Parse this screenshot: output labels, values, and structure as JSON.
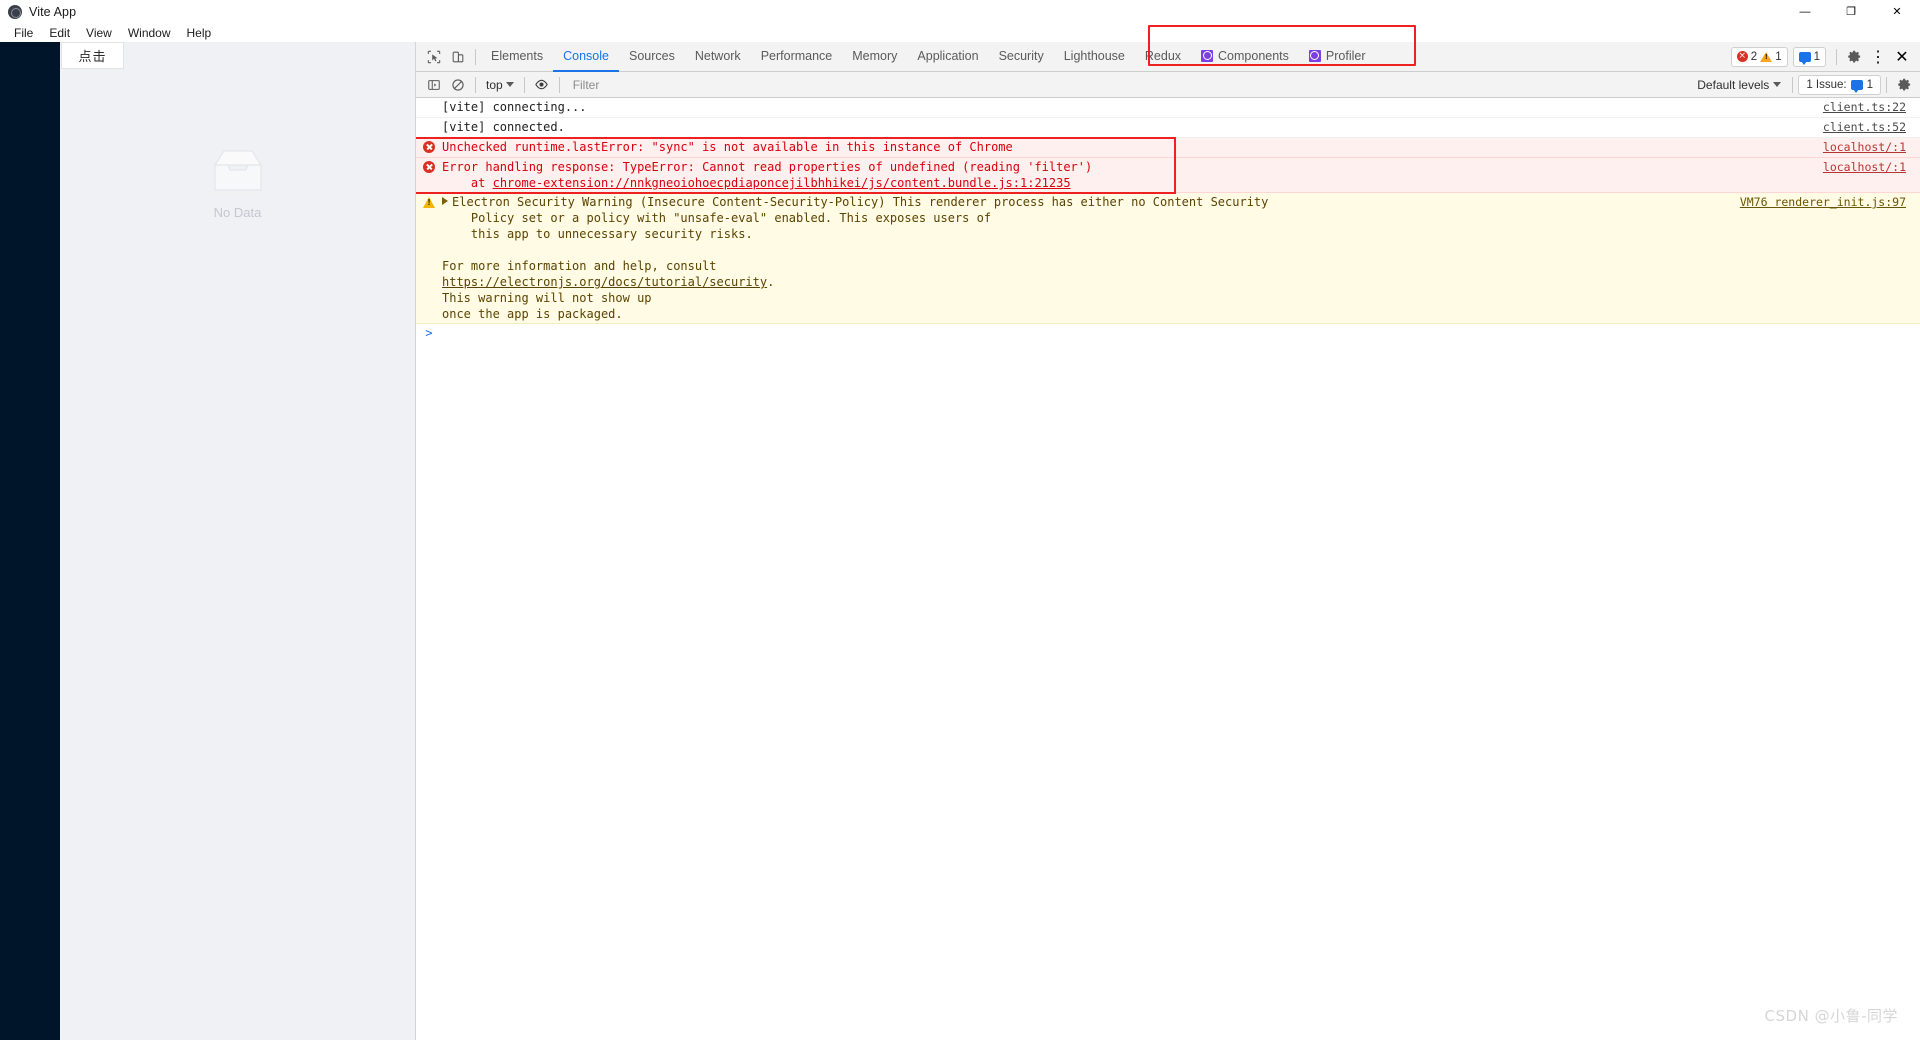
{
  "window": {
    "title": "Vite App",
    "minimize_label": "—",
    "maximize_label": "❐",
    "close_label": "✕"
  },
  "menubar": {
    "items": [
      "File",
      "Edit",
      "View",
      "Window",
      "Help"
    ]
  },
  "app": {
    "click_button_label": "点击",
    "empty_text": "No Data",
    "sidebar_color": "#001529"
  },
  "devtools": {
    "tabs": [
      {
        "label": "Elements",
        "active": false
      },
      {
        "label": "Console",
        "active": true
      },
      {
        "label": "Sources",
        "active": false
      },
      {
        "label": "Network",
        "active": false
      },
      {
        "label": "Performance",
        "active": false
      },
      {
        "label": "Memory",
        "active": false
      },
      {
        "label": "Application",
        "active": false
      },
      {
        "label": "Security",
        "active": false
      },
      {
        "label": "Lighthouse",
        "active": false
      }
    ],
    "extension_tabs": [
      {
        "label": "Redux",
        "icon": false
      },
      {
        "label": "Components",
        "icon": true
      },
      {
        "label": "Profiler",
        "icon": true
      }
    ],
    "counters": {
      "errors": "2",
      "warnings": "1",
      "messages": "1"
    },
    "settings_label": "⚙",
    "more_label": "⋮",
    "close_label": "✕",
    "active_tab_color": "#1a73e8",
    "highlight_color": "#ef2020"
  },
  "console_toolbar": {
    "context": "top",
    "filter_placeholder": "Filter",
    "filter_value": "",
    "levels": "Default levels",
    "issues_label": "1 Issue:",
    "issues_count": "1"
  },
  "console_messages": [
    {
      "kind": "log",
      "text": "[vite] connecting...",
      "source": "client.ts:22"
    },
    {
      "kind": "log",
      "text": "[vite] connected.",
      "source": "client.ts:52"
    },
    {
      "kind": "error",
      "text": "Unchecked runtime.lastError: \"sync\" is not available in this instance of Chrome",
      "source": "localhost/:1"
    },
    {
      "kind": "error",
      "text": "Error handling response: TypeError: Cannot read properties of undefined (reading 'filter')",
      "at_prefix": "    at ",
      "at_link": "chrome-extension://nnkgneoiohoecpdiaponcejilbhhikei/js/content.bundle.js:1:21235",
      "source": "localhost/:1"
    },
    {
      "kind": "warning",
      "text_head": "Electron Security Warning (Insecure Content-Security-Policy) This renderer process has either no Content Security\n    Policy set or a policy with \"unsafe-eval\" enabled. This exposes users of\n    this app to unnecessary security risks.\n",
      "text_mid": "\nFor more information and help, consult\n",
      "link": "https://electronjs.org/docs/tutorial/security",
      "text_tail": ".\nThis warning will not show up\nonce the app is packaged.",
      "source": "VM76 renderer_init.js:97"
    }
  ],
  "console_prompt": {
    "caret": ">",
    "value": ""
  },
  "watermark": "CSDN @小鲁-同学"
}
